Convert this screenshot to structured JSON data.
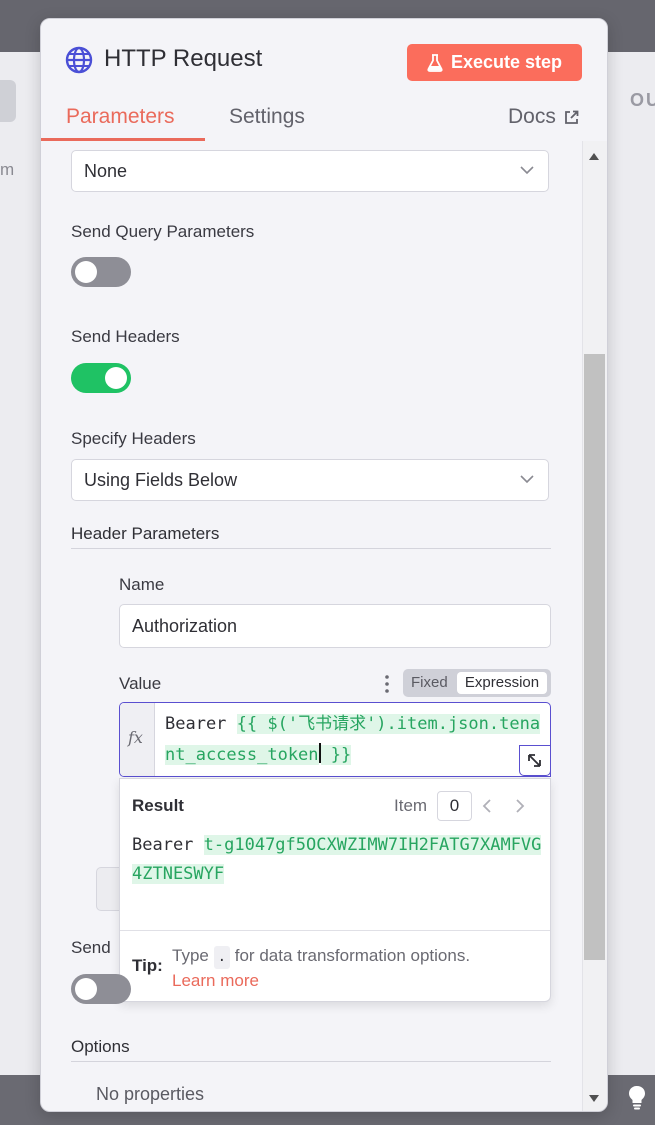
{
  "header": {
    "title": "HTTP Request",
    "execute_label": "Execute step",
    "tabs": [
      {
        "label": "Parameters",
        "active": true
      },
      {
        "label": "Settings",
        "active": false
      }
    ],
    "docs_label": "Docs"
  },
  "fields": {
    "authentication_value": "None",
    "send_query_label": "Send Query Parameters",
    "send_query_on": false,
    "send_headers_label": "Send Headers",
    "send_headers_on": true,
    "specify_headers_label": "Specify Headers",
    "specify_headers_value": "Using Fields Below",
    "header_params_label": "Header Parameters",
    "name_label": "Name",
    "name_value": "Authorization",
    "value_label": "Value",
    "mode_fixed": "Fixed",
    "mode_expression": "Expression",
    "expression_prefix": "Bearer ",
    "expression_code": "{{ $('飞书请求').item.json.tenant_access_token",
    "expression_suffix": " }}",
    "send_body_label": "Send",
    "send_body_on": false,
    "options_label": "Options",
    "no_properties": "No properties"
  },
  "result": {
    "title": "Result",
    "item_label": "Item",
    "item_index": "0",
    "value_prefix": "Bearer ",
    "value_token": "t-g1047gf5OCXWZIMW7IH2FATG7XAMFVG4ZTNESWYF",
    "tip_label": "Tip:",
    "tip_before": "Type ",
    "tip_dot": ".",
    "tip_after": " for data transformation options.",
    "learn_more": "Learn more"
  },
  "background": {
    "left_text": "m",
    "right_text": "OU"
  },
  "colors": {
    "accent": "#fb6d5c",
    "toggle_on": "#1fc264",
    "toggle_off": "#8e8e96",
    "expression_highlight": "#27a560"
  }
}
